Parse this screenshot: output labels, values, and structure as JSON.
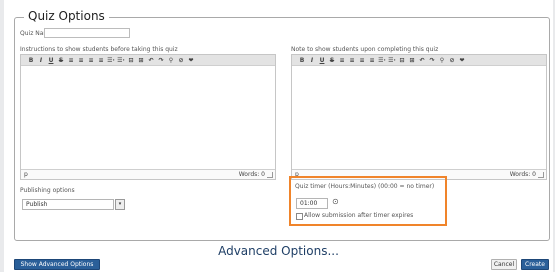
{
  "fieldset": {
    "legend": "Quiz Options"
  },
  "quiz_name": {
    "label": "Quiz Name",
    "value": ""
  },
  "editor_before": {
    "label": "Instructions to show students before taking this quiz",
    "status_path": "p",
    "word_count": "Words: 0"
  },
  "editor_after": {
    "label": "Note to show students upon completing this quiz",
    "status_path": "p",
    "word_count": "Words: 0"
  },
  "toolbar": {
    "bold": "B",
    "italic": "I",
    "underline": "U",
    "strike": "S",
    "align_left": "≡",
    "align_center": "≡",
    "align_right": "≡",
    "justify": "≡",
    "bullets": "☰·",
    "numbers": "☰·",
    "outdent": "⊟",
    "indent": "⊞",
    "undo": "↶",
    "redo": "↷",
    "link": "⚲",
    "unlink": "⊘",
    "more": "❤"
  },
  "publishing": {
    "label": "Publishing options",
    "value": "Publish"
  },
  "timer": {
    "label": "Quiz timer (Hours:Minutes) (00:00 = no timer)",
    "value": "01:00",
    "checkbox_label": "Allow submission after timer expires"
  },
  "advanced_title": "Advanced Options...",
  "buttons": {
    "advanced": "Show Advanced Options",
    "cancel": "Cancel",
    "create": "Create"
  },
  "colors": {
    "highlight": "#f0842a",
    "primary_button": "#2a5f99",
    "heading": "#1f3f66"
  }
}
